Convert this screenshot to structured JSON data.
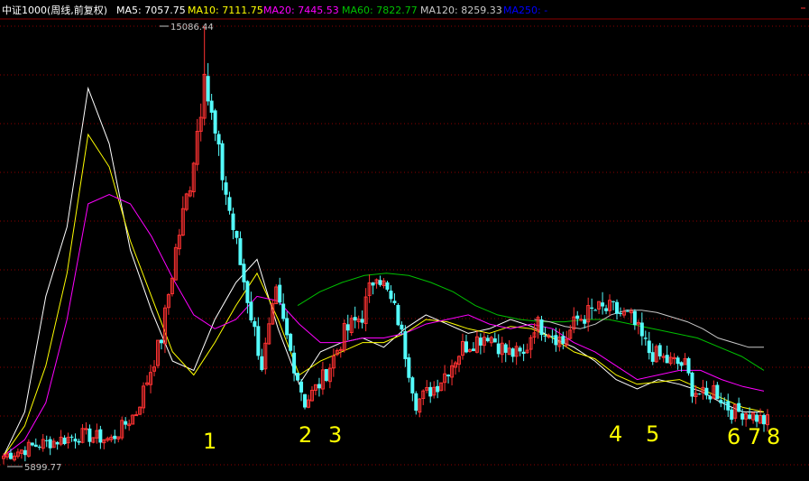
{
  "header": {
    "name": "中证1000(周线,前复权)",
    "ma5": "MA5: 7057.75",
    "ma10": "MA10: 7111.75",
    "ma20": "MA20: 7445.53",
    "ma60": "MA60: 7822.77",
    "ma120": "MA120: 8259.33",
    "ma250": "MA250: -"
  },
  "colors": {
    "background": "#000000",
    "up": "#ff3232",
    "down": "#54fcfc",
    "grid": "#8b0000",
    "ma5": "#ffffff",
    "ma10": "#ffff00",
    "ma20": "#ff00ff",
    "ma60": "#00c000",
    "ma120": "#c8c8c8",
    "annotation": "#ffff00",
    "header_ma250": "#0000ff"
  },
  "chart_data": {
    "type": "candlestick",
    "title": "中证1000(周线,前复权)",
    "ylim": [
      5800,
      15400
    ],
    "max_label": "15086.44",
    "min_label": "5899.77",
    "annotations": [
      "1",
      "2",
      "3",
      "4",
      "5",
      "6",
      "7",
      "8"
    ],
    "key_x": [
      0,
      10,
      22,
      30,
      37,
      44,
      48,
      52,
      56,
      60,
      66,
      72,
      76,
      80,
      84,
      88,
      91,
      95,
      100,
      104,
      110,
      115,
      121,
      128,
      135,
      140,
      145,
      148,
      152,
      156,
      160,
      165,
      170,
      175,
      180,
      185,
      190,
      192,
      196,
      198,
      203,
      207,
      212
    ],
    "key_close": [
      6050,
      6300,
      6500,
      6400,
      7000,
      8600,
      10500,
      12000,
      14200,
      12500,
      10200,
      8000,
      9500,
      8300,
      7200,
      7600,
      8000,
      8700,
      9100,
      10100,
      9000,
      7200,
      7600,
      8400,
      8700,
      8300,
      8200,
      8900,
      8800,
      8500,
      9000,
      9200,
      9200,
      9000,
      8300,
      8100,
      8000,
      7500,
      7300,
      7500,
      7000,
      7000,
      6800
    ],
    "ma_series": [
      {
        "name": "MA5",
        "values": [
          6050,
          7000,
          9500,
          11000,
          14000,
          12800,
          10500,
          9200,
          8100,
          7900,
          9000,
          9800,
          10300,
          8800,
          7600,
          8300,
          8500,
          8600,
          8400,
          8800,
          9100,
          8900,
          8700,
          8800,
          9000,
          8850,
          8600,
          8400,
          8100,
          7700,
          7500,
          7700,
          7600,
          7450,
          7200,
          7000,
          7000
        ]
      },
      {
        "name": "MA10",
        "values": [
          6050,
          6700,
          8000,
          10000,
          13000,
          12300,
          10700,
          9500,
          8300,
          7800,
          8500,
          9300,
          10000,
          9000,
          7800,
          8100,
          8300,
          8500,
          8500,
          8700,
          9000,
          8950,
          8800,
          8700,
          8850,
          8800,
          8600,
          8300,
          8150,
          7800,
          7600,
          7650,
          7700,
          7500,
          7300,
          7100,
          7000
        ]
      },
      {
        "name": "MA20",
        "values": [
          6050,
          6400,
          7200,
          9000,
          11500,
          11700,
          11500,
          10800,
          9900,
          9100,
          8800,
          9000,
          9500,
          9400,
          8900,
          8500,
          8500,
          8600,
          8600,
          8700,
          8900,
          9000,
          9100,
          8900,
          8800,
          8900,
          8800,
          8500,
          8300,
          8000,
          7700,
          7800,
          7900,
          7900,
          7700,
          7550,
          7450
        ]
      },
      {
        "name": "MA60",
        "values": [
          9300,
          9600,
          9800,
          9950,
          10000,
          9950,
          9800,
          9600,
          9300,
          9100,
          9000,
          8950,
          8950,
          9000,
          9000,
          8900,
          8800,
          8700,
          8600,
          8400,
          8200,
          7900
        ]
      },
      {
        "name": "MA120",
        "values": [
          9000,
          8950,
          8850,
          8800,
          8900,
          9100,
          9200,
          9200,
          9150,
          9050,
          8950,
          8800,
          8600,
          8500,
          8400,
          8400
        ]
      }
    ]
  }
}
